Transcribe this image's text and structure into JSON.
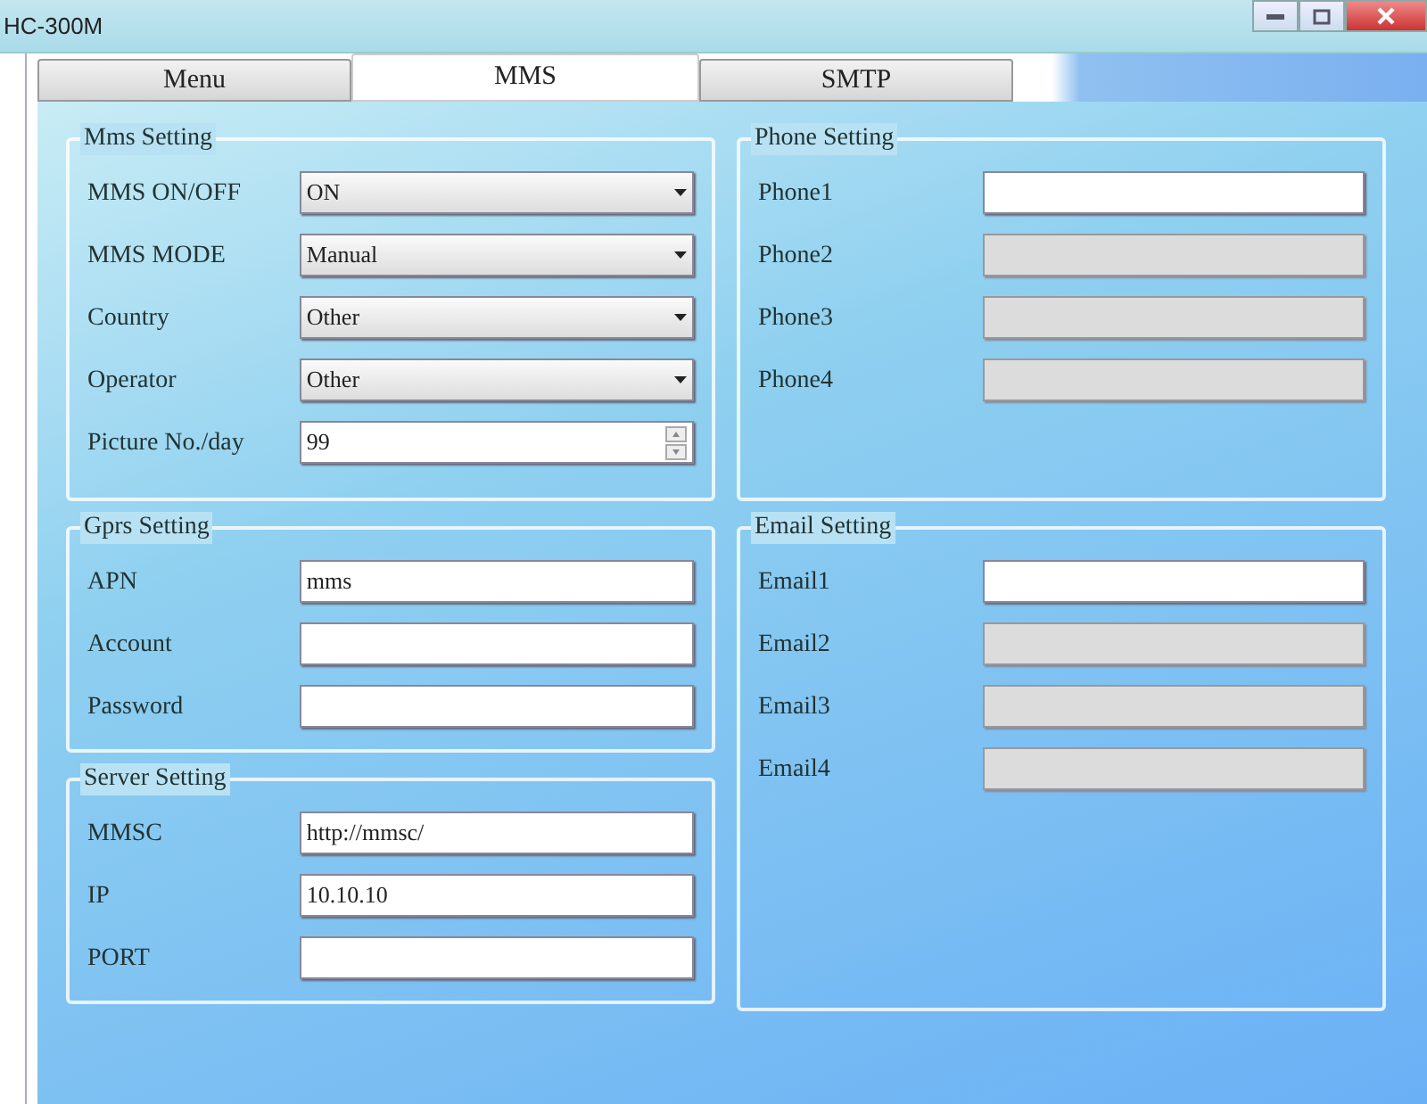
{
  "window": {
    "title": "HC-300M"
  },
  "tabs": [
    {
      "label": "Menu",
      "selected": false
    },
    {
      "label": "MMS",
      "selected": true
    },
    {
      "label": "SMTP",
      "selected": false
    }
  ],
  "left_groups": [
    {
      "title": "Mms Setting",
      "fields": [
        {
          "label": "MMS ON/OFF",
          "kind": "select",
          "value": "ON"
        },
        {
          "label": "MMS MODE",
          "kind": "select",
          "value": "Manual"
        },
        {
          "label": "Country",
          "kind": "select",
          "value": "Other"
        },
        {
          "label": "Operator",
          "kind": "select",
          "value": "Other"
        },
        {
          "label": "Picture No./day",
          "kind": "spin",
          "value": "99"
        }
      ]
    },
    {
      "title": "Gprs Setting",
      "fields": [
        {
          "label": "APN",
          "kind": "text",
          "value": "mms"
        },
        {
          "label": "Account",
          "kind": "text"
        },
        {
          "label": "Password",
          "kind": "text"
        }
      ]
    },
    {
      "title": "Server Setting",
      "fields": [
        {
          "label": "MMSC",
          "kind": "text",
          "value": "http://mmsc/"
        },
        {
          "label": "IP",
          "kind": "text",
          "value": "10.10.10"
        },
        {
          "label": "PORT",
          "kind": "text"
        }
      ]
    }
  ],
  "right_groups": [
    {
      "title": "Phone Setting",
      "fields": [
        {
          "label": "Phone1",
          "kind": "text",
          "disabled": false
        },
        {
          "label": "Phone2",
          "kind": "text",
          "disabled": true
        },
        {
          "label": "Phone3",
          "kind": "text",
          "disabled": true
        },
        {
          "label": "Phone4",
          "kind": "text",
          "disabled": true
        }
      ]
    },
    {
      "title": "Email Setting",
      "fields": [
        {
          "label": "Email1",
          "kind": "text",
          "disabled": false
        },
        {
          "label": "Email2",
          "kind": "text",
          "disabled": true
        },
        {
          "label": "Email3",
          "kind": "text",
          "disabled": true
        },
        {
          "label": "Email4",
          "kind": "text",
          "disabled": true
        }
      ]
    }
  ]
}
